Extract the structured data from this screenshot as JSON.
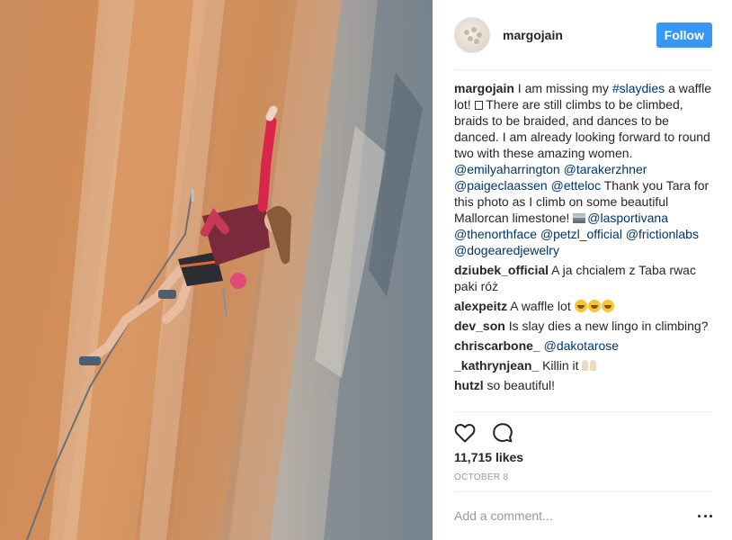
{
  "post": {
    "username": "margojain",
    "follow_label": "Follow",
    "likes": "11,715 likes",
    "date": "OCTOBER 8",
    "add_comment_placeholder": "Add a comment...",
    "caption": {
      "username": "margojain",
      "t1": "I am missing my",
      "tag1": "#slaydies",
      "t2": "a waffle lot!",
      "t3": "There are still climbs to be climbed, braids to be braided, and dances to be danced. I am already looking forward to round two with these amazing women.",
      "m1": "@emilyaharrington",
      "m2": "@tarakerzhner",
      "m3": "@paigeclaassen",
      "m4": "@etteloc",
      "t4": "Thank you Tara for this photo as I climb on some beautiful Mallorcan limestone!",
      "m5": "@lasportivana",
      "m6": "@thenorthface",
      "m7": "@petzl_official",
      "m8": "@frictionlabs",
      "m9": "@dogearedjewelry"
    },
    "comments": [
      {
        "username": "dziubek_official",
        "text": "A ja chcialem z Taba rwac paki róż"
      },
      {
        "username": "alexpeitz",
        "text": "A waffle lot"
      },
      {
        "username": "dev_son",
        "text": "Is slay dies a new lingo in climbing?"
      },
      {
        "username": "chriscarbone_",
        "mention": "@dakotarose"
      },
      {
        "username": "_kathrynjean_",
        "text": "Killin it"
      },
      {
        "username": "hutzl",
        "text": "so beautiful!"
      }
    ]
  },
  "icons": {
    "heart": "heart-icon",
    "comment": "comment-bubble-icon",
    "more": "more-options-icon",
    "avatar": "avatar-image"
  },
  "colors": {
    "follow": "#3897f0",
    "link": "#003569",
    "muted": "#999999"
  }
}
